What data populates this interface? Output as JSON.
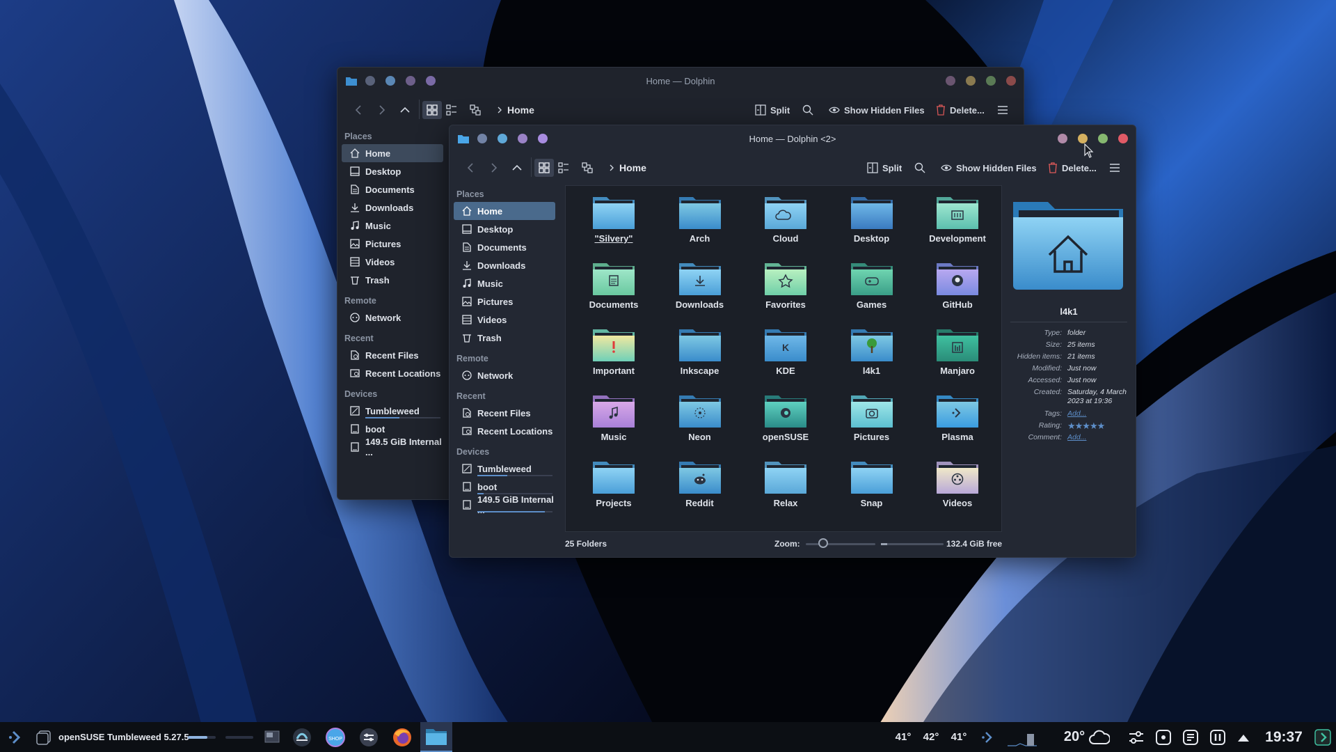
{
  "colors": {
    "accent": "#5d8ec9",
    "folder_light": "#7ec8e3",
    "folder_dark": "#2e7fb0"
  },
  "back_window": {
    "title": "Home — Dolphin",
    "breadcrumb": "Home",
    "toolbar": {
      "split": "Split",
      "show_hidden": "Show Hidden Files",
      "delete": "Delete..."
    },
    "places": {
      "places_header": "Places",
      "items": [
        "Home",
        "Desktop",
        "Documents",
        "Downloads",
        "Music",
        "Pictures",
        "Videos",
        "Trash"
      ],
      "remote_header": "Remote",
      "remote": [
        "Network"
      ],
      "recent_header": "Recent",
      "recent": [
        "Recent Files",
        "Recent Locations"
      ],
      "devices_header": "Devices",
      "devices": [
        "Tumbleweed",
        "boot",
        "149.5 GiB Internal ..."
      ]
    }
  },
  "front_window": {
    "title": "Home — Dolphin <2>",
    "breadcrumb": "Home",
    "toolbar": {
      "split": "Split",
      "show_hidden": "Show Hidden Files",
      "delete": "Delete..."
    },
    "places": {
      "places_header": "Places",
      "items": [
        "Home",
        "Desktop",
        "Documents",
        "Downloads",
        "Music",
        "Pictures",
        "Videos",
        "Trash"
      ],
      "remote_header": "Remote",
      "remote": [
        "Network"
      ],
      "recent_header": "Recent",
      "recent": [
        "Recent Files",
        "Recent Locations"
      ],
      "devices_header": "Devices",
      "devices": [
        "Tumbleweed",
        "boot",
        "149.5 GiB Internal ..."
      ]
    },
    "folders": [
      "\"Silvery\"",
      "Arch",
      "Cloud",
      "Desktop",
      "Development",
      "Documents",
      "Downloads",
      "Favorites",
      "Games",
      "GitHub",
      "Important",
      "Inkscape",
      "KDE",
      "l4k1",
      "Manjaro",
      "Music",
      "Neon",
      "openSUSE",
      "Pictures",
      "Plasma",
      "Projects",
      "Reddit",
      "Relax",
      "Snap",
      "Videos"
    ],
    "status": {
      "count": "25 Folders",
      "zoom_label": "Zoom:",
      "free": "132.4 GiB free",
      "free_fraction": 0.1
    },
    "info": {
      "name": "l4k1",
      "type_k": "Type:",
      "type_v": "folder",
      "size_k": "Size:",
      "size_v": "25 items",
      "hidden_k": "Hidden items:",
      "hidden_v": "21 items",
      "modified_k": "Modified:",
      "modified_v": "Just now",
      "accessed_k": "Accessed:",
      "accessed_v": "Just now",
      "created_k": "Created:",
      "created_v": "Saturday, 4 March 2023 at 19:36",
      "tags_k": "Tags:",
      "tags_v": "Add...",
      "rating_k": "Rating:",
      "rating": 5,
      "comment_k": "Comment:",
      "comment_v": "Add..."
    }
  },
  "taskbar": {
    "active_window": "openSUSE Tumbleweed 5.27.5",
    "temps": [
      "41°",
      "42°",
      "41°"
    ],
    "weather": "20°",
    "clock": "19:37"
  }
}
